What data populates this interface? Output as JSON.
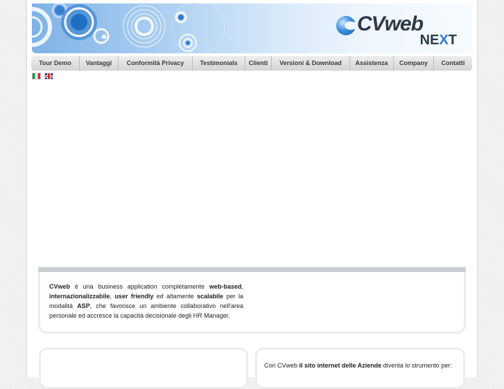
{
  "logo": {
    "cv": "CVweb",
    "next_prefix": "NE",
    "next_x": "X",
    "next_suffix": "T"
  },
  "nav": {
    "items": [
      {
        "label": "Tour Demo"
      },
      {
        "label": "Vantaggi"
      },
      {
        "label": "Conformità Privacy"
      },
      {
        "label": "Testimonials"
      },
      {
        "label": "Clienti"
      },
      {
        "label": "Versioni & Download"
      },
      {
        "label": "Assistenza"
      },
      {
        "label": "Company"
      },
      {
        "label": "Contatti"
      }
    ]
  },
  "languages": [
    {
      "name": "italian-flag-icon"
    },
    {
      "name": "uk-flag-icon"
    }
  ],
  "intro": {
    "p1_bold": "CVweb",
    "p1": " è una business application completamente ",
    "p2_bold": "web-based",
    "p2": ", ",
    "p3_bold": "internazionalizzabile",
    "p3": ", ",
    "p4_bold": "user friendly",
    "p4": " ed altamente ",
    "p5_bold": "scalabile",
    "p5": " per la modalità ",
    "p6_bold": "ASP",
    "p6": ", che favorisce un ambiente collaborativo nell'area personale ed accresce la capacità decisionale degli HR Manager."
  },
  "right_box": {
    "t1": "Con CVweb ",
    "t2_bold": "il sito internet delle Aziende",
    "t3": " diventa lo strumento per:"
  },
  "colors": {
    "banner_blue": "#2a79d4",
    "nav_bg": "#dddddd"
  }
}
